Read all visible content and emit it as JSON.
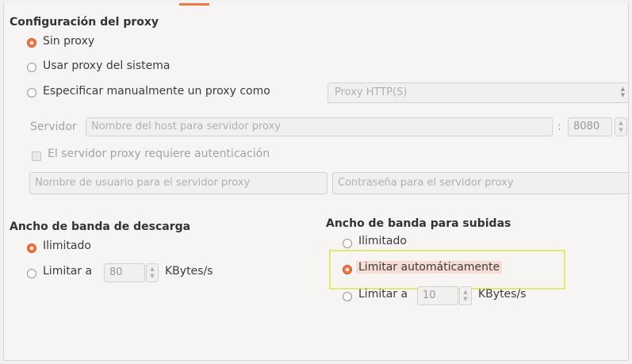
{
  "proxy": {
    "heading": "Configuración del proxy",
    "options": [
      {
        "label": "Sin proxy",
        "selected": true
      },
      {
        "label": "Usar proxy del sistema",
        "selected": false
      },
      {
        "label": "Especificar manualmente un proxy como",
        "selected": false
      }
    ],
    "type_select": {
      "value": "Proxy HTTP(S)"
    },
    "server_label": "Servidor",
    "host_placeholder": "Nombre del host para servidor proxy",
    "port_separator": ":",
    "port_value": "8080",
    "auth_checkbox_label": "El servidor proxy requiere autenticación",
    "auth_checked": false,
    "username_placeholder": "Nombre de usuario para el servidor proxy",
    "password_placeholder": "Contraseña para el servidor proxy"
  },
  "download": {
    "heading": "Ancho de banda de descarga",
    "options": [
      {
        "label": "Ilimitado",
        "selected": true
      },
      {
        "label": "Limitar a",
        "selected": false
      }
    ],
    "limit_value": "80",
    "unit": "KBytes/s"
  },
  "upload": {
    "heading": "Ancho de banda para subidas",
    "options": [
      {
        "label": "Ilimitado",
        "selected": false
      },
      {
        "label": "Limitar automáticamente",
        "selected": true
      },
      {
        "label": "Limitar a",
        "selected": false
      }
    ],
    "limit_value": "10",
    "unit": "KBytes/s"
  },
  "colors": {
    "accent": "#f07746",
    "highlight_border": "#e5e86c",
    "highlight_fill": "#f6dcd3"
  },
  "icons": {
    "spin_up": "▲",
    "spin_down": "▼"
  }
}
